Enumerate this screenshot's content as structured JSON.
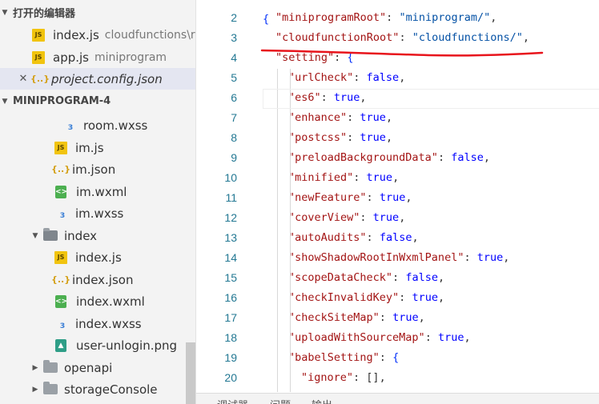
{
  "explorer": {
    "open_editors_label": "打开的编辑器",
    "project_label": "MINIPROGRAM-4",
    "open_files": [
      {
        "name": "index.js",
        "path": "cloudfunctions\\rp",
        "icon": "js-file-icon"
      },
      {
        "name": "app.js",
        "path": "miniprogram",
        "icon": "js-file-icon"
      },
      {
        "name": "project.config.json",
        "path": "",
        "icon": "json-file-icon"
      }
    ],
    "tree": [
      {
        "name": "room.wxss",
        "icon": "wxss-file-icon"
      },
      {
        "name": "im.js",
        "icon": "js-file-icon"
      },
      {
        "name": "im.json",
        "icon": "json-file-icon"
      },
      {
        "name": "im.wxml",
        "icon": "wxml-file-icon"
      },
      {
        "name": "im.wxss",
        "icon": "wxss-file-icon"
      },
      {
        "name": "index",
        "icon": "folder-open-icon"
      },
      {
        "name": "index.js",
        "icon": "js-file-icon"
      },
      {
        "name": "index.json",
        "icon": "json-file-icon"
      },
      {
        "name": "index.wxml",
        "icon": "wxml-file-icon"
      },
      {
        "name": "index.wxss",
        "icon": "wxss-file-icon"
      },
      {
        "name": "user-unlogin.png",
        "icon": "image-file-icon"
      },
      {
        "name": "openapi",
        "icon": "folder-icon"
      },
      {
        "name": "storageConsole",
        "icon": "folder-icon"
      }
    ]
  },
  "editor": {
    "lines": [
      {
        "n": "2",
        "key": "\"miniprogramRoot\"",
        "val": "\"miniprogram/\"",
        "kind": "str",
        "end": ","
      },
      {
        "n": "3",
        "key": "\"cloudfunctionRoot\"",
        "val": "\"cloudfunctions/\"",
        "kind": "str",
        "end": ","
      },
      {
        "n": "4",
        "key": "\"setting\"",
        "val": "{",
        "kind": "bracket",
        "end": ""
      },
      {
        "n": "5",
        "key": "\"urlCheck\"",
        "val": "false",
        "kind": "bool",
        "end": ","
      },
      {
        "n": "6",
        "key": "\"es6\"",
        "val": "true",
        "kind": "bool",
        "end": ","
      },
      {
        "n": "7",
        "key": "\"enhance\"",
        "val": "true",
        "kind": "bool",
        "end": ","
      },
      {
        "n": "8",
        "key": "\"postcss\"",
        "val": "true",
        "kind": "bool",
        "end": ","
      },
      {
        "n": "9",
        "key": "\"preloadBackgroundData\"",
        "val": "false",
        "kind": "bool",
        "end": ","
      },
      {
        "n": "10",
        "key": "\"minified\"",
        "val": "true",
        "kind": "bool",
        "end": ","
      },
      {
        "n": "11",
        "key": "\"newFeature\"",
        "val": "true",
        "kind": "bool",
        "end": ","
      },
      {
        "n": "12",
        "key": "\"coverView\"",
        "val": "true",
        "kind": "bool",
        "end": ","
      },
      {
        "n": "13",
        "key": "\"autoAudits\"",
        "val": "false",
        "kind": "bool",
        "end": ","
      },
      {
        "n": "14",
        "key": "\"showShadowRootInWxmlPanel\"",
        "val": "true",
        "kind": "bool",
        "end": ","
      },
      {
        "n": "15",
        "key": "\"scopeDataCheck\"",
        "val": "false",
        "kind": "bool",
        "end": ","
      },
      {
        "n": "16",
        "key": "\"checkInvalidKey\"",
        "val": "true",
        "kind": "bool",
        "end": ","
      },
      {
        "n": "17",
        "key": "\"checkSiteMap\"",
        "val": "true",
        "kind": "bool",
        "end": ","
      },
      {
        "n": "18",
        "key": "\"uploadWithSourceMap\"",
        "val": "true",
        "kind": "bool",
        "end": ","
      },
      {
        "n": "19",
        "key": "\"babelSetting\"",
        "val": "{",
        "kind": "bracket",
        "end": ""
      },
      {
        "n": "20",
        "key": "\"ignore\"",
        "val": "[]",
        "kind": "punc",
        "end": ","
      }
    ],
    "top_partial": "{"
  },
  "bottom_panel": {
    "tabs": [
      "调试器",
      "问题",
      "输出"
    ]
  },
  "colors": {
    "annotation_underline": "#e8141c",
    "line_number": "#237893",
    "json_key": "#a31515",
    "json_string": "#0451a5",
    "json_bool": "#0000ff"
  }
}
